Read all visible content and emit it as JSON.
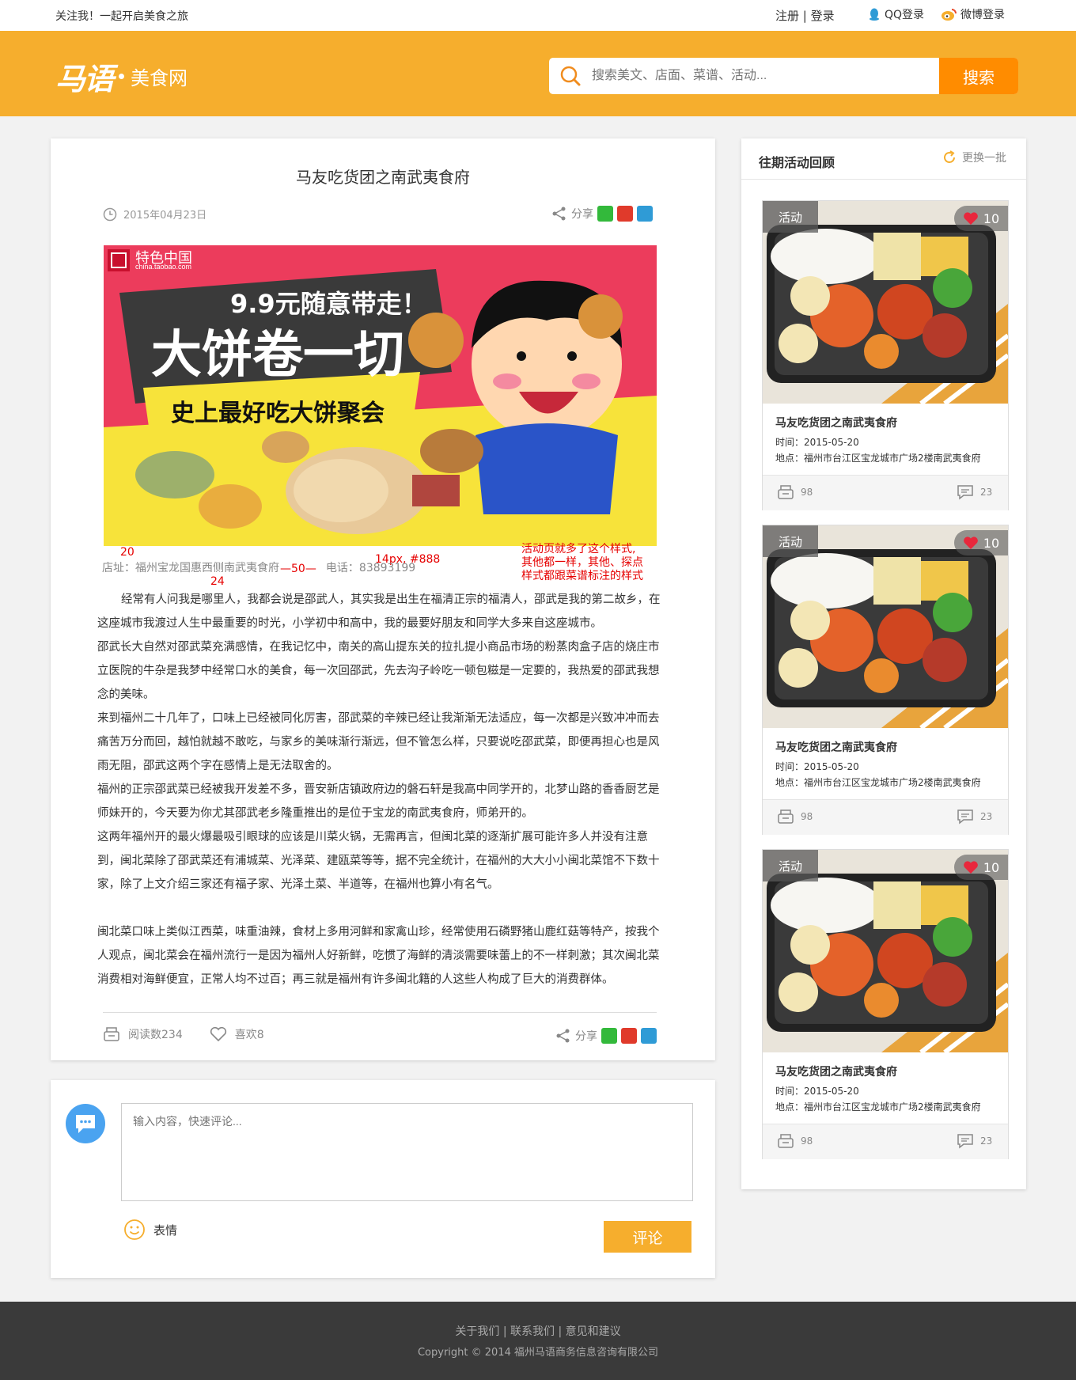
{
  "topbar": {
    "slogan": "关注我！一起开启美食之旅",
    "register": "注册",
    "divider": "|",
    "login": "登录",
    "qq_login": "QQ登录",
    "weibo_login": "微博登录"
  },
  "header": {
    "logo_mark": "马语",
    "logo_name": "美食网",
    "search_placeholder": "搜索美文、店面、菜谱、活动...",
    "search_button": "搜索"
  },
  "article": {
    "title": "马友吃货团之南武夷食府",
    "date": "2015年04月23日",
    "share_label": "分享",
    "banner": {
      "brand": "特色中国",
      "brand_sub": "china.taobao.com",
      "price_line": "9.9元随意带走！",
      "headline": "大饼卷一切",
      "subline": "史上最好吃大饼聚会"
    },
    "shop_label": "店址：",
    "shop_address": "福州宝龙国惠西侧南武夷食府",
    "phone_label": "电话：",
    "phone": "83893199",
    "annotations": {
      "n20": "20",
      "n24": "24",
      "n50": "—50—",
      "font_note": "14px, #888",
      "note_line1": "活动页就多了这个样式,",
      "note_line2": "其他都一样，其他、探点",
      "note_line3": "样式都跟菜谱标注的样式"
    },
    "paragraphs": [
      "经常有人问我是哪里人，我都会说是邵武人，其实我是出生在福清正宗的福清人，邵武是我的第二故乡，在这座城市我渡过人生中最重要的时光，小学初中和高中，我的最要好朋友和同学大多来自这座城市。",
      "邵武长大自然对邵武菜充满感情，在我记忆中，南关的高山提东关的拉扎提小商品市场的粉蒸肉盒子店的烧庄市立医院的牛杂是我梦中经常口水的美食，每一次回邵武，先去沟子岭吃一顿包糍是一定要的，我热爱的邵武我想念的美味。",
      "来到福州二十几年了，口味上已经被同化厉害，邵武菜的辛辣已经让我渐渐无法适应，每一次都是兴致冲冲而去痛苦万分而回，越怕就越不敢吃，与家乡的美味渐行渐远，但不管怎么样，只要说吃邵武菜，即便再担心也是风雨无阻，邵武这两个字在感情上是无法取舍的。",
      "福州的正宗邵武菜已经被我开发差不多，晋安新店镇政府边的磐石轩是我高中同学开的，北梦山路的香香厨艺是师妹开的，今天要为你尤其邵武老乡隆重推出的是位于宝龙的南武夷食府，师弟开的。",
      "这两年福州开的最火爆最吸引眼球的应该是川菜火锅，无需再言，但闽北菜的逐渐扩展可能许多人并没有注意到，闽北菜除了邵武菜还有浦城菜、光泽菜、建瓯菜等等，据不完全统计，在福州的大大小小闽北菜馆不下数十家，除了上文介绍三家还有福子家、光泽土菜、半道等，在福州也算小有名气。",
      "闽北菜口味上类似江西菜，味重油辣，食材上多用河鲜和家禽山珍，经常使用石磷野猪山鹿红菇等特产，按我个人观点，闽北菜会在福州流行一是因为福州人好新鲜，吃惯了海鲜的清淡需要味蕾上的不一样刺激；其次闽北菜消费相对海鲜便宜，正常人均不过百；再三就是福州有许多闽北籍的人这些人构成了巨大的消费群体。"
    ],
    "read_count": "阅读数234",
    "like_count": "喜欢8",
    "share_label_bottom": "分享"
  },
  "comment": {
    "placeholder": "输入内容，快速评论...",
    "emoji_label": "表情",
    "submit": "评论"
  },
  "sidebar": {
    "title": "往期活动回顾",
    "refresh": "更换一批",
    "cards": [
      {
        "tag": "活动",
        "likes": "10",
        "title": "马友吃货团之南武夷食府",
        "date": "时间：2015-05-20",
        "address": "地点：福州市台江区宝龙城市广场2楼南武夷食府",
        "reads": "98",
        "comments": "23"
      },
      {
        "tag": "活动",
        "likes": "10",
        "title": "马友吃货团之南武夷食府",
        "date": "时间：2015-05-20",
        "address": "地点：福州市台江区宝龙城市广场2楼南武夷食府",
        "reads": "98",
        "comments": "23"
      },
      {
        "tag": "活动",
        "likes": "10",
        "title": "马友吃货团之南武夷食府",
        "date": "时间：2015-05-20",
        "address": "地点：福州市台江区宝龙城市广场2楼南武夷食府",
        "reads": "98",
        "comments": "23"
      }
    ]
  },
  "footer": {
    "about": "关于我们",
    "contact": "联系我们",
    "feedback": "意见和建议",
    "sep": "|",
    "copyright": "Copyright © 2014 福州马语商务信息咨询有限公司"
  },
  "colors": {
    "brand_orange": "#f6ae2d",
    "search_button": "#ff8c00",
    "annotation_red": "#e60000",
    "footer_bg": "#3a3a3a"
  },
  "icons": [
    "clock-icon",
    "share-icon",
    "wechat-icon",
    "weibo-icon",
    "qzone-icon",
    "qq-icon",
    "search-icon",
    "refresh-icon",
    "heart-icon",
    "read-icon",
    "comment-icon",
    "smile-icon",
    "chat-bubble-icon"
  ]
}
